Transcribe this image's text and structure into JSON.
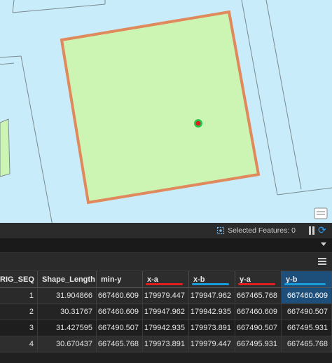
{
  "status_bar": {
    "selected_features_text": "Selected Features: 0",
    "selected_features_icon": "selection-icon",
    "pause_icon": "pause-icon",
    "refresh_icon": "refresh-icon"
  },
  "colors": {
    "parcel_fill": "#ccf5b4",
    "parcel_outline": "#e0895c",
    "map_background": "#c8ecfa",
    "point_marker": "#e02020",
    "selected_column": "#1e4e7a",
    "annotation_red": "#e01e1e",
    "annotation_blue": "#1a9cd8"
  },
  "table": {
    "columns": [
      {
        "label": "RIG_SEQ",
        "annotation": null
      },
      {
        "label": "Shape_Length",
        "annotation": null
      },
      {
        "label": "min-y",
        "annotation": null
      },
      {
        "label": "x-a",
        "annotation": "red"
      },
      {
        "label": "x-b",
        "annotation": "blue"
      },
      {
        "label": "y-a",
        "annotation": "red"
      },
      {
        "label": "y-b",
        "annotation": "blue",
        "selected": true
      }
    ],
    "rows": [
      [
        "1",
        "31.904866",
        "667460.609",
        "179979.447",
        "179947.962",
        "667465.768",
        "667460.609"
      ],
      [
        "2",
        "30.31767",
        "667460.609",
        "179947.962",
        "179942.935",
        "667460.609",
        "667490.507"
      ],
      [
        "3",
        "31.427595",
        "667490.507",
        "179942.935",
        "179973.891",
        "667490.507",
        "667495.931"
      ],
      [
        "4",
        "30.670437",
        "667465.768",
        "179973.891",
        "179979.447",
        "667495.931",
        "667465.768"
      ]
    ]
  }
}
